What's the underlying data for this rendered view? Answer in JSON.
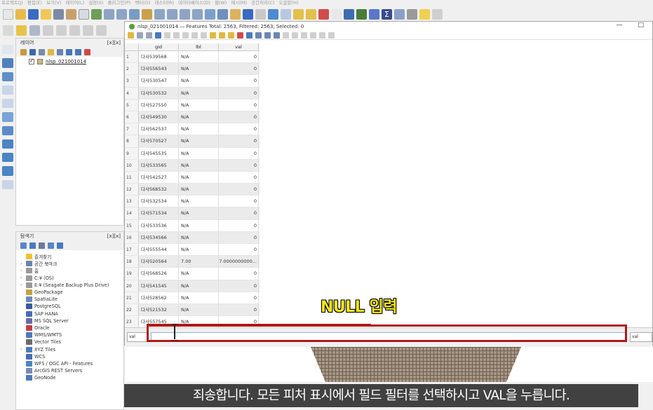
{
  "menubar": {
    "items": [
      "프로젝트(J)",
      "편집(E)",
      "보기(V)",
      "레이어(L)",
      "설정(S)",
      "플러그인(P)",
      "벡터(O)",
      "래스터(R)",
      "데이터베이스(D)",
      "웹(W)",
      "메시(M)",
      "공간처리(C)",
      "도움말(H)"
    ]
  },
  "layers_panel": {
    "title": "레이어",
    "controls": "[x][x]",
    "layer_name": "nlsp_021001014"
  },
  "browser_panel": {
    "title": "탐색기",
    "controls": "[x][x]",
    "items": [
      "즐겨찾기",
      "공간 북마크",
      "홈",
      "C:¥ (OS)",
      "E:¥ (Seagate Backup Plus Drive)",
      "GeoPackage",
      "SpatiaLite",
      "PostgreSQL",
      "SAP HANA",
      "MS SQL Server",
      "Oracle",
      "WMS/WMTS",
      "Vector Tiles",
      "XYZ Tiles",
      "WCS",
      "WFS / OGC API - Features",
      "ArcGIS REST Servers",
      "GeoNode"
    ]
  },
  "attribute_table": {
    "title": "nlsp_021001014 — Features Total: 2563, Filtered: 2563, Selected: 0",
    "minimize": "—",
    "maximize": "□",
    "columns": [
      "gid",
      "lbl",
      "val"
    ],
    "rows": [
      {
        "n": "1",
        "gid": "다사539568",
        "lbl": "N/A",
        "val": "0"
      },
      {
        "n": "2",
        "gid": "다사556543",
        "lbl": "N/A",
        "val": "0"
      },
      {
        "n": "3",
        "gid": "다사530547",
        "lbl": "N/A",
        "val": "0"
      },
      {
        "n": "4",
        "gid": "다사530532",
        "lbl": "N/A",
        "val": "0"
      },
      {
        "n": "5",
        "gid": "다사527550",
        "lbl": "N/A",
        "val": "0"
      },
      {
        "n": "6",
        "gid": "다사549530",
        "lbl": "N/A",
        "val": "0"
      },
      {
        "n": "7",
        "gid": "다사562537",
        "lbl": "N/A",
        "val": "0"
      },
      {
        "n": "8",
        "gid": "다사570527",
        "lbl": "N/A",
        "val": "0"
      },
      {
        "n": "9",
        "gid": "다사545535",
        "lbl": "N/A",
        "val": "0"
      },
      {
        "n": "10",
        "gid": "다사533565",
        "lbl": "N/A",
        "val": "0"
      },
      {
        "n": "11",
        "gid": "다사542527",
        "lbl": "N/A",
        "val": "0"
      },
      {
        "n": "12",
        "gid": "다사568532",
        "lbl": "N/A",
        "val": "0"
      },
      {
        "n": "13",
        "gid": "다사532534",
        "lbl": "N/A",
        "val": "0"
      },
      {
        "n": "14",
        "gid": "다사571534",
        "lbl": "N/A",
        "val": "0"
      },
      {
        "n": "15",
        "gid": "다사533536",
        "lbl": "N/A",
        "val": "0"
      },
      {
        "n": "16",
        "gid": "다사534566",
        "lbl": "N/A",
        "val": "0"
      },
      {
        "n": "17",
        "gid": "다사555544",
        "lbl": "N/A",
        "val": "0"
      },
      {
        "n": "18",
        "gid": "다사520564",
        "lbl": "7.00",
        "val": "7.0000000000..."
      },
      {
        "n": "19",
        "gid": "다사568526",
        "lbl": "N/A",
        "val": "0"
      },
      {
        "n": "20",
        "gid": "다사541545",
        "lbl": "N/A",
        "val": "0"
      },
      {
        "n": "21",
        "gid": "다사528562",
        "lbl": "N/A",
        "val": "0"
      },
      {
        "n": "22",
        "gid": "다사521532",
        "lbl": "N/A",
        "val": "0"
      },
      {
        "n": "23",
        "gid": "다사557545",
        "lbl": "N/A",
        "val": "0"
      }
    ],
    "field_selector": "val",
    "field_selector_right": "val"
  },
  "annotation": {
    "text": "NULL 입력",
    "color": "#f2e51a",
    "box_color": "#b01818"
  },
  "subtitle": {
    "text": "죄송합니다. 모든 피처 표시에서 필드 필터를 선택하시고 VAL을 누릅니다."
  }
}
